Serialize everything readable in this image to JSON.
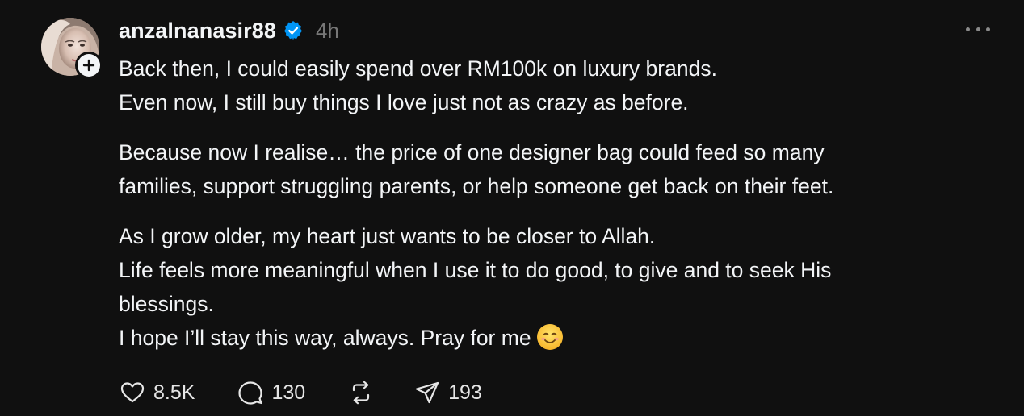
{
  "post": {
    "username": "anzalnanasir88",
    "timestamp": "4h",
    "paragraphs": [
      [
        "Back then, I could easily spend over RM100k on luxury brands.",
        "Even now, I still buy things I love just not as crazy as before."
      ],
      [
        "Because now I realise… the price of one designer bag could feed so many",
        "families, support struggling parents, or help someone get back on their feet."
      ],
      [
        "As I grow older, my heart just wants to be closer to Allah.",
        "Life feels more meaningful when I use it to do good, to give and to seek His",
        "blessings.",
        "I hope I’ll stay this way, always. Pray for me"
      ]
    ]
  },
  "actions": {
    "likes": "8.5K",
    "comments": "130",
    "shares": "193"
  },
  "icons": {
    "verified": "verified-badge-icon",
    "more": "more-options-icon",
    "like": "heart-icon",
    "comment": "comment-bubble-icon",
    "repost": "repost-icon",
    "share": "paper-plane-icon",
    "emoji": "smiling-face-emoji",
    "follow": "plus-icon"
  },
  "colors": {
    "background": "#101010",
    "text": "#f3f5f7",
    "muted": "#777777",
    "verified": "#0095f6"
  }
}
